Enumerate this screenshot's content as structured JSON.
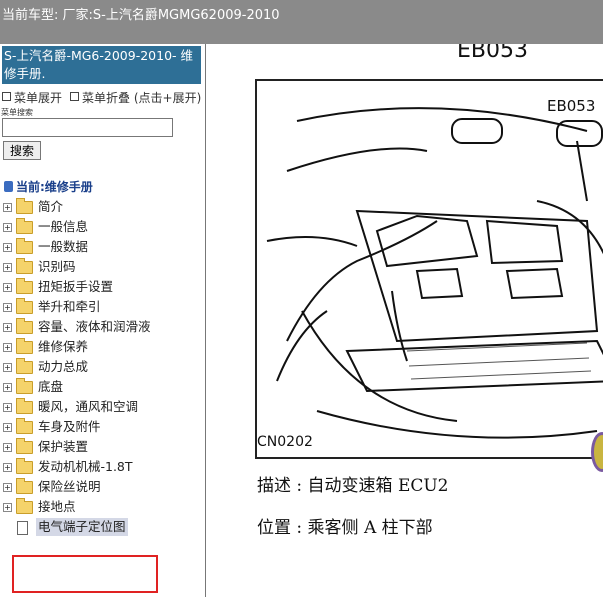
{
  "titlebar": {
    "text": "当前车型:   厂家:S-上汽名爵MGMG62009-2010"
  },
  "sidebar": {
    "title": "S-上汽名爵-MG6-2009-2010- 维修手册.",
    "menu_expand": "菜单展开",
    "menu_collapse": "菜单折叠 (点击+展开)",
    "search_label": "菜单搜索",
    "search_value": "",
    "search_button": "搜索",
    "current_label": "当前:维修手册",
    "tree_items": [
      {
        "label": "简介"
      },
      {
        "label": "一般信息"
      },
      {
        "label": "一般数据"
      },
      {
        "label": "识别码"
      },
      {
        "label": "扭矩扳手设置"
      },
      {
        "label": "举升和牵引"
      },
      {
        "label": "容量、液体和润滑液"
      },
      {
        "label": "维修保养"
      },
      {
        "label": "动力总成"
      },
      {
        "label": "底盘"
      },
      {
        "label": "暖风，通风和空调"
      },
      {
        "label": "车身及附件"
      },
      {
        "label": "保护装置"
      },
      {
        "label": "发动机机械-1.8T"
      },
      {
        "label": "保险丝说明"
      },
      {
        "label": "接地点"
      }
    ],
    "selected_item": "电气端子定位图"
  },
  "content": {
    "code_top": "EB053",
    "figure_label_connector": "EB053",
    "figure_label_code": "CN0202",
    "description": "描述 : 自动变速箱 ECU2",
    "location": "位置 : 乘客侧 A 柱下部"
  },
  "colors": {
    "sidebar_title_bg": "#2e6f96",
    "highlight_border": "#e02222",
    "titlebar_bg": "#8a8a8a"
  }
}
